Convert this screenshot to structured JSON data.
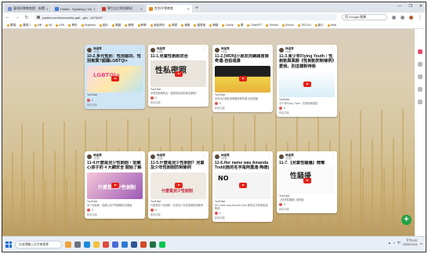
{
  "browser": {
    "tabs": [
      {
        "label": "臺灣科學教育館｜新聞公告",
        "active": false
      },
      {
        "label": "Padlet - Speaking / Netli...",
        "active": false
      },
      {
        "label": "學生自主學習網站",
        "active": false
      },
      {
        "label": "性別平等教育",
        "active": true
      }
    ],
    "url": "padlet.com/shonas/tha-gab...gbc...4b73d37",
    "search_placeholder": "用 Google 搜尋",
    "window_controls": [
      "—",
      "❐",
      "✕"
    ],
    "bookmarks": [
      "雲端",
      "雲端 1",
      "BB",
      "IM",
      "ASK",
      "學校",
      "Graphics",
      "圖片",
      "電腦",
      "管理",
      "教學",
      "班級資料",
      "學習",
      "蒐集",
      "圖書館",
      "網路",
      "Canva",
      "雲",
      "ChatGPT",
      "Gemini",
      "School",
      "TED-Ed",
      "影片",
      "Web"
    ]
  },
  "cards": [
    {
      "author": "林品秀",
      "time": "5天前",
      "title": "10-2.多元性別：性別認同、性別氣質?認識LGBTQI+",
      "thumb_text": "LGBTQI+",
      "source": "YouTube",
      "description": "",
      "likes": "0",
      "comment": "新增評論",
      "blue": true
    },
    {
      "author": "林品秀",
      "time": "5天前",
      "title": "11-1.兒童性剝削防治",
      "thumb_text": "性私密照",
      "source": "YouTube",
      "description": "兒童性剝削防治｜被誘拍私密影像怎麼辦？",
      "likes": "0",
      "comment": "新增評論",
      "blue": false
    },
    {
      "author": "林品秀",
      "time": "5天前",
      "title": "11-2.[WDN]小朋友的網路冒險奇遇-自拍是誰",
      "thumb_text": "",
      "source": "YouTube",
      "description": "[WDN]小朋友的網路冒險奇遇-自拍是誰",
      "likes": "0",
      "comment": "新增評論",
      "blue": false
    },
    {
      "author": "林品秀",
      "time": "5天前",
      "title": "11-3.青少年Flying Youth｜性剝削與風險《性剝削防制條例》愛我，別這樣對待我",
      "thumb_text": "",
      "source": "YouTube",
      "description": "青少年Flying Youth｜性剝削與風險",
      "likes": "0",
      "comment": "新增評論",
      "blue": false
    },
    {
      "author": "林品秀",
      "time": "5天前",
      "title": "11-4.什麼是兒少性剝削・從關心孩子的 4 大網安全 開始了解",
      "thumb_text": "什麼是兒少性剝削",
      "source": "YouTube",
      "description": "兒少性剝削・從關心孩子的網路安全開始",
      "likes": "0",
      "comment": "新增評論",
      "blue": false
    },
    {
      "author": "林品秀",
      "time": "5天前",
      "title": "11-5.什麼是兒少性剝削？兒童及少年性剝削防制條例",
      "thumb_text": "什麼是兒少性剝削",
      "source": "YouTube",
      "description": "什麼是兒少性剝削｜兒童及少年性剝削防制條例",
      "likes": "0",
      "comment": "新增評論",
      "blue": false
    },
    {
      "author": "林品秀",
      "time": "5天前",
      "title": "11-6.Her name was Amanda Todd(她的名字是阿曼達·陶德)",
      "thumb_text": "NO",
      "source": "YouTube",
      "description": "Her name was Amanda Todd 她的名字是阿曼達·陶德",
      "likes": "0",
      "comment": "新增評論",
      "blue": false
    },
    {
      "author": "林品秀",
      "time": "5天前",
      "title": "11-7.【兒童性騷擾】微電",
      "thumb_text": "性騷擾",
      "source": "YouTube",
      "description": "【兒童性騷擾】微電影",
      "likes": "0",
      "comment": "新增評論",
      "blue": false
    }
  ],
  "fab_label": "+",
  "taskbar": {
    "search_placeholder": "在這裡輸入文字來搜尋",
    "tray_lang": "中",
    "time": "下午2:20",
    "date": "2025/11/24"
  },
  "colors": {
    "accent": "#23a047",
    "youtube": "#e62117",
    "highlight_card": "#cfe6f6"
  }
}
